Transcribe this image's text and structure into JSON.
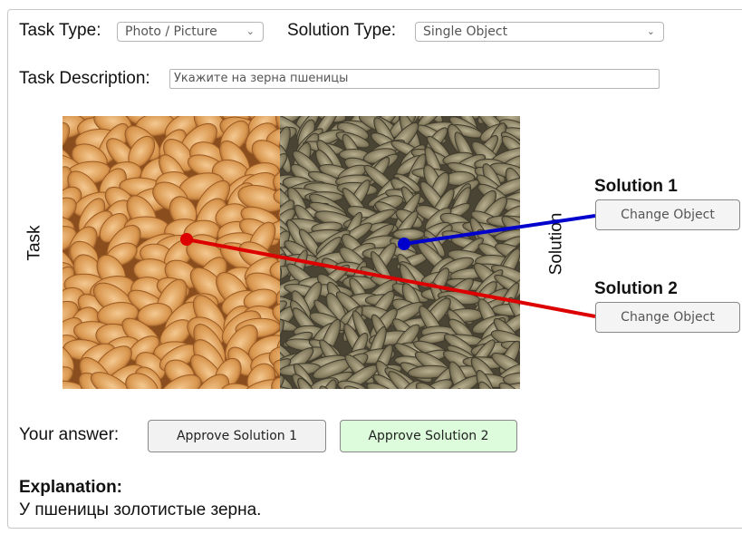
{
  "form": {
    "task_type_label": "Task Type:",
    "task_type_value": "Photo / Picture",
    "solution_type_label": "Solution Type:",
    "solution_type_value": "Single Object",
    "task_description_label": "Task Description:",
    "task_description_value": "Укажите на зерна пшеницы"
  },
  "task_panel": {
    "task_label": "Task",
    "solution_label": "Solution"
  },
  "solutions": [
    {
      "title": "Solution 1",
      "button_label": "Change Object",
      "color": "#0000cc"
    },
    {
      "title": "Solution 2",
      "button_label": "Change Object",
      "color": "#dd0000"
    }
  ],
  "answer": {
    "label": "Your answer:",
    "approve_1": "Approve Solution 1",
    "approve_2": "Approve Solution 2"
  },
  "explanation": {
    "title": "Explanation:",
    "text": "У пшеницы золотистые зерна."
  },
  "icons": {
    "dropdown": "chevron-down-icon"
  }
}
